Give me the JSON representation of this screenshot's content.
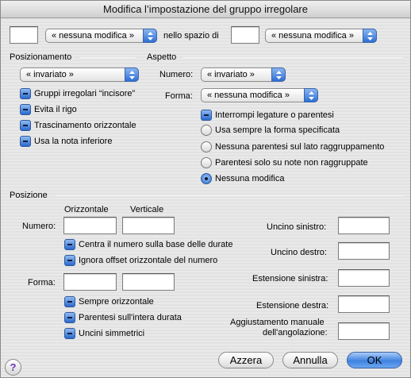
{
  "title": "Modifica l’impostazione del gruppo irregolare",
  "top": {
    "count_value": "",
    "popup1": "« nessuna modifica »",
    "space_label": "nello spazio di",
    "space_value": "",
    "popup2": "« nessuna modifica »"
  },
  "posizionamento": {
    "header": "Posizionamento",
    "popup": "« invariato »",
    "checks": [
      "Gruppi irregolari “incisore”",
      "Evita il rigo",
      "Trascinamento orizzontale",
      "Usa la nota inferiore"
    ]
  },
  "aspetto": {
    "header": "Aspetto",
    "numero_label": "Numero:",
    "numero_popup": "« invariato »",
    "forma_label": "Forma:",
    "forma_popup": "« nessuna modifica »",
    "check": "Interrompi legature o parentesi",
    "radios": [
      "Usa sempre la forma specificata",
      "Nessuna parentesi sul lato raggruppamento",
      "Parentesi solo su note non raggruppate",
      "Nessuna modifica"
    ],
    "radio_selected": "Nessuna modifica"
  },
  "posizione": {
    "header": "Posizione",
    "col_orizzontale": "Orizzontale",
    "col_verticale": "Verticale",
    "numero_label": "Numero:",
    "forma_label": "Forma:",
    "numero_checks": [
      "Centra il numero sulla base delle durate",
      "Ignora offset orizzontale del numero"
    ],
    "forma_checks": [
      "Sempre orizzontale",
      "Parentesi sull'intera durata",
      "Uncini simmetrici"
    ],
    "right_labels": {
      "uncino_sinistro": "Uncino sinistro:",
      "uncino_destro": "Uncino destro:",
      "estensione_sinistra": "Estensione sinistra:",
      "estensione_destra": "Estensione destra:",
      "aggiustamento_1": "Aggiustamento manuale",
      "aggiustamento_2": "dell'angolazione:"
    }
  },
  "buttons": {
    "help": "?",
    "azzera": "Azzera",
    "annulla": "Annulla",
    "ok": "OK"
  }
}
